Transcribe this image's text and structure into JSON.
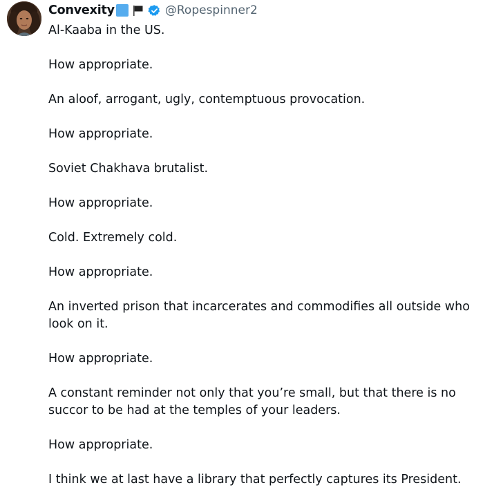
{
  "user": {
    "display_name": "Convexity",
    "handle": "@Ropespinner2",
    "avatar_icon": "profile-photo",
    "verified_icon": "verified-badge-icon",
    "emojis": [
      "blue-square-icon",
      "black-flag-icon"
    ],
    "verified_color": "#1d9bf0"
  },
  "tweet": {
    "paragraphs": [
      "Al-Kaaba in the US.",
      "How appropriate.",
      "An aloof, arrogant, ugly, contemptuous provocation.",
      "How appropriate.",
      "Soviet Chakhava brutalist.",
      "How appropriate.",
      "Cold. Extremely cold.",
      "How appropriate.",
      "An inverted prison that incarcerates and commodifies all outside who look on it.",
      "How appropriate.",
      "A constant reminder not only that you’re small, but that there is no succor to be had at the temples of your leaders.",
      "How appropriate.",
      "I think we at last have a library that perfectly captures its President."
    ]
  }
}
